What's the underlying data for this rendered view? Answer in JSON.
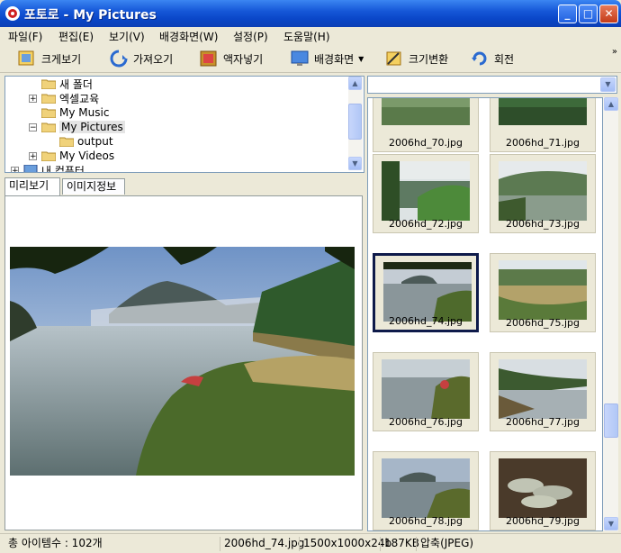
{
  "window": {
    "title": "포토로 - My Pictures"
  },
  "menu": [
    "파일(F)",
    "편집(E)",
    "보기(V)",
    "배경화면(W)",
    "설정(P)",
    "도움말(H)"
  ],
  "toolbar": {
    "zoom": "크게보기",
    "import": "가져오기",
    "frame": "액자넣기",
    "wallpaper": "배경화면",
    "resize": "크기변환",
    "rotate": "회전",
    "more": "»"
  },
  "tree": {
    "items": [
      "새 폴더",
      "엑셀교육",
      "My Music",
      "My Pictures",
      "output",
      "My Videos",
      "내 컴퓨터"
    ]
  },
  "tabs": {
    "preview": "미리보기",
    "info": "이미지정보"
  },
  "thumbs": [
    "2006hd_70.jpg",
    "2006hd_71.jpg",
    "2006hd_72.jpg",
    "2006hd_73.jpg",
    "2006hd_74.jpg",
    "2006hd_75.jpg",
    "2006hd_76.jpg",
    "2006hd_77.jpg",
    "2006hd_78.jpg",
    "2006hd_79.jpg"
  ],
  "status": {
    "count": "총 아이템수 : 102개",
    "file": "2006hd_74.jpg",
    "dims": "1500x1000x24b",
    "size": "187KB",
    "format": "압축(JPEG)"
  },
  "colors": {
    "titlebar": "#0a46c8",
    "selected_border": "#0e1a4a"
  }
}
